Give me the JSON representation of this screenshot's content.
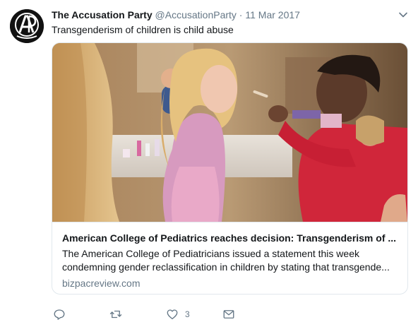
{
  "tweet": {
    "author_name": "The Accusation Party",
    "handle": "@AccusationParty",
    "separator": "·",
    "date": "11 Mar 2017",
    "text": "Transgenderism of children is child abuse",
    "avatar_monogram": "AP"
  },
  "card": {
    "title": "American College of Pediatrics reaches decision: Transgenderism of ...",
    "description_line1": "The American College of Pediatricians issued a statement this week",
    "description_line2": "condemning gender reclassification in children by stating that transgende...",
    "domain": "bizpacreview.com",
    "image_description_icon": "photo"
  },
  "actions": {
    "reply_icon": "reply-icon",
    "retweet_icon": "retweet-icon",
    "like_icon": "heart-icon",
    "like_count": "3",
    "dm_icon": "envelope-icon"
  },
  "colors": {
    "text": "#14171a",
    "secondary": "#657786",
    "border": "#e1e8ed"
  }
}
